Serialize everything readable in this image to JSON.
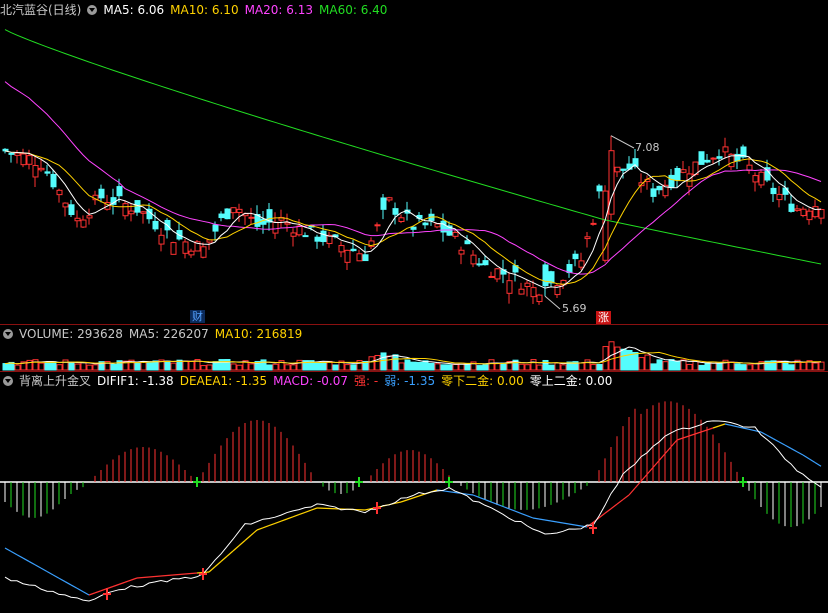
{
  "chart_data": [
    {
      "type": "candlestick",
      "title": "北汽蓝谷(日线)",
      "indicators": [
        {
          "name": "MA5",
          "value": "6.06",
          "color": "#ffffff"
        },
        {
          "name": "MA10",
          "value": "6.10",
          "color": "#ffd200"
        },
        {
          "name": "MA20",
          "value": "6.13",
          "color": "#ff44ff"
        },
        {
          "name": "MA60",
          "value": "6.40",
          "color": "#22dd22"
        }
      ],
      "annotations": {
        "high_label": "7.08",
        "low_label": "5.69",
        "badge_cai": "财",
        "badge_zhang": "涨"
      },
      "ylim": [
        5.5,
        8.1
      ],
      "colors": {
        "up": "#ff3232",
        "down": "#54fcfc"
      }
    },
    {
      "type": "bar",
      "title": "VOLUME",
      "indicators": [
        {
          "name": "VOLUME",
          "value": "293628",
          "color": "#c8c8c8"
        },
        {
          "name": "MA5",
          "value": "226207",
          "color": "#c8c8c8"
        },
        {
          "name": "MA10",
          "value": "216819",
          "color": "#ffd200"
        }
      ]
    },
    {
      "type": "line",
      "title": "背离上升金叉",
      "indicators": [
        {
          "name": "DIFIF1",
          "value": "-1.38",
          "color": "#ffffff"
        },
        {
          "name": "DEAEA1",
          "value": "-1.35",
          "color": "#ffd200"
        },
        {
          "name": "MACD",
          "value": "-0.07",
          "color": "#ff44ff"
        },
        {
          "name": "强",
          "value": "-",
          "color": "#ff3232"
        },
        {
          "name": "弱",
          "value": "-1.35",
          "color": "#3aa0ff"
        },
        {
          "name": "零下二金",
          "value": "0.00",
          "color": "#ffd200"
        },
        {
          "name": "零上二金",
          "value": "0.00",
          "color": "#ffffff"
        }
      ],
      "colors": {
        "hist_up": "#ff3232",
        "hist_down": "#22dd22",
        "axis": "#ffffff"
      }
    }
  ]
}
